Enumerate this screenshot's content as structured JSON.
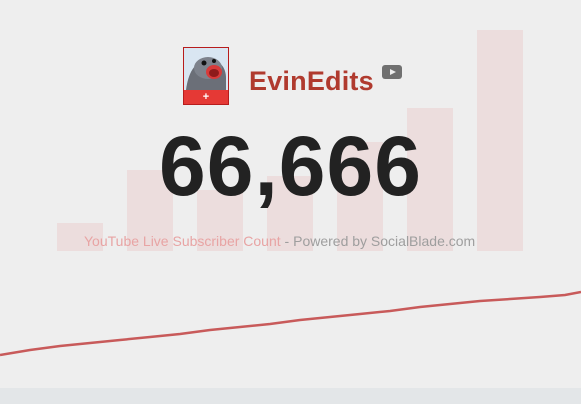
{
  "channel": {
    "name": "EvinEdits",
    "avatar_badge": "+",
    "platform_icon": "youtube-icon"
  },
  "counter": {
    "value": "66,666"
  },
  "footer_text": {
    "youtube_label": "YouTube Live Subscriber Count",
    "separator": "-",
    "powered_label": "Powered by SocialBlade.com"
  },
  "colors": {
    "channel_name": "#b03a2e",
    "graph_line": "#c85a5a",
    "background": "#eeeeee",
    "bars": "#e9c8c8"
  }
}
